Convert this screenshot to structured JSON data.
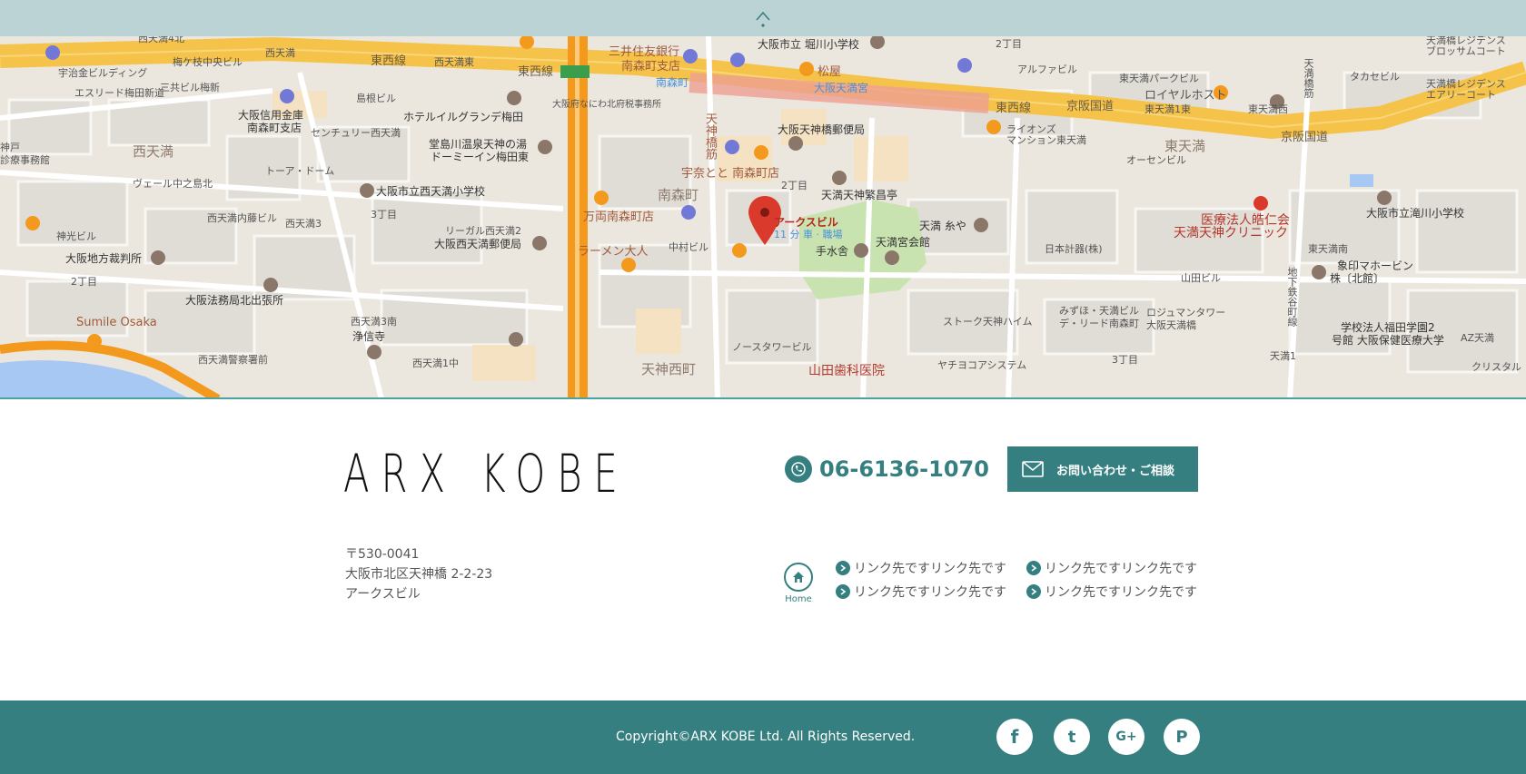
{
  "top": {
    "scroll_top_icon": "chevron-up-icon"
  },
  "map": {
    "labels": {
      "l1": "西天満4北",
      "l2": "西天満",
      "l3": "東西線",
      "l4": "西天満東",
      "l5": "東西線",
      "l6": "三井住友銀行",
      "l7": "南森町支店",
      "l8": "大阪市立 堀川小学校",
      "l9": "2丁目",
      "l10": "松屋",
      "l11": "アルファビル",
      "l12": "東天満パークビル",
      "l13": "天満橋レジデンス",
      "l14": "ブロッサムコート",
      "l15": "天満橋レジデンス",
      "l16": "エアリーコート",
      "l17": "タカセビル",
      "l18": "宇治金ビルディング",
      "l19": "梅ケ枝中央ビル",
      "l20": "エスリード梅田新道",
      "l21": "三共ビル梅新",
      "l22": "島根ビル",
      "l23": "大阪府なにわ北府税事務所",
      "l24": "南森町",
      "l25": "大阪天満宮",
      "l26": "東西線",
      "l27": "京阪国道",
      "l28": "東天満1東",
      "l29": "東天満西",
      "l30": "京阪国道",
      "l31": "ロイヤルホスト",
      "l32": "大阪信用金庫",
      "l33": "南森町支店",
      "l34": "センチュリー西天満",
      "l35": "ホテルイルグランデ梅田",
      "l36": "堂島川温泉天神の湯",
      "l37": "ドーミーイン梅田東",
      "l38": "天神橋筋",
      "l39": "大阪天神橋郵便局",
      "l40": "宇奈とと 南森町店",
      "l41": "ライオンズ",
      "l42": "マンション東天満",
      "l43": "東天満",
      "l44": "オーセンビル",
      "l45": "西天満",
      "l46": "トーア・ドーム",
      "l47": "ヴェール中之島北",
      "l48": "大阪市立西天満小学校",
      "l49": "南森町",
      "l50": "2丁目",
      "l51": "天満天神繁昌亭",
      "l52": "大阪市立滝川小学校",
      "l53": "西天満内藤ビル",
      "l54": "西天満3",
      "l55": "3丁目",
      "l56": "万両南森町店",
      "l57": "アークスビル",
      "l58": "11 分 車 · 職場",
      "l59": "天満 糸や",
      "l60": "医療法人皓仁会",
      "l61": "天満天神クリニック",
      "l62": "リーガル西天満2",
      "l63": "大阪西天満郵便局",
      "l64": "ラーメン大人",
      "l65": "中村ビル",
      "l66": "手水舎",
      "l67": "天満宮会館",
      "l68": "日本計器(株)",
      "l69": "東天満南",
      "l70": "象印マホービン",
      "l71": "株〔北館〕",
      "l72": "神光ビル",
      "l73": "大阪地方裁判所",
      "l74": "2丁目",
      "l75": "山田ビル",
      "l76": "大阪法務局北出張所",
      "l77": "西天満3南",
      "l78": "みずほ・天満ビル",
      "l79": "デ・リード南森町",
      "l80": "ロジュマンタワー",
      "l81": "大阪天満橋",
      "l82": "ストーク天神ハイム",
      "l83": "学校法人福田学園2",
      "l84": "号館 大阪保健医療大学",
      "l85": "AZ天満",
      "l86": "Sumile Osaka",
      "l87": "浄信寺",
      "l88": "天神西町",
      "l89": "ノースタワービル",
      "l90": "西天満警察署前",
      "l91": "西天満1中",
      "l92": "山田歯科医院",
      "l93": "ヤチヨコアシステム",
      "l94": "3丁目",
      "l95": "天満1",
      "l96": "クリスタル",
      "l97": "地下鉄谷町線",
      "l98": "天満橋筋",
      "l99": "神戸",
      "l100": "診療事務館"
    }
  },
  "brand": {
    "logo_text": "ARX KOBE"
  },
  "address": {
    "postal": "〒530-0041",
    "street": "大阪市北区天神橋 2-2-23",
    "building": "アークスビル"
  },
  "contact": {
    "phone": "06-6136-1070",
    "button_label": "お問い合わせ・ご相談"
  },
  "nav": {
    "home_label": "Home",
    "links": [
      "リンク先ですリンク先です",
      "リンク先ですリンク先です",
      "リンク先ですリンク先です",
      "リンク先ですリンク先です"
    ]
  },
  "footer": {
    "copyright": "Copyright©ARX KOBE Ltd. All Rights Reserved.",
    "social": [
      {
        "name": "facebook-icon",
        "glyph": "f"
      },
      {
        "name": "twitter-icon",
        "glyph": "t"
      },
      {
        "name": "google-plus-icon",
        "glyph": "G+"
      },
      {
        "name": "pinterest-icon",
        "glyph": "P"
      }
    ]
  },
  "colors": {
    "accent": "#357f80",
    "top_bar": "#bcd3d6",
    "road_major": "#f6c34a",
    "road_orange": "#f39a1e",
    "pin": "#d93a2b",
    "park": "#c9e3b0",
    "water": "#a7c8f2"
  }
}
